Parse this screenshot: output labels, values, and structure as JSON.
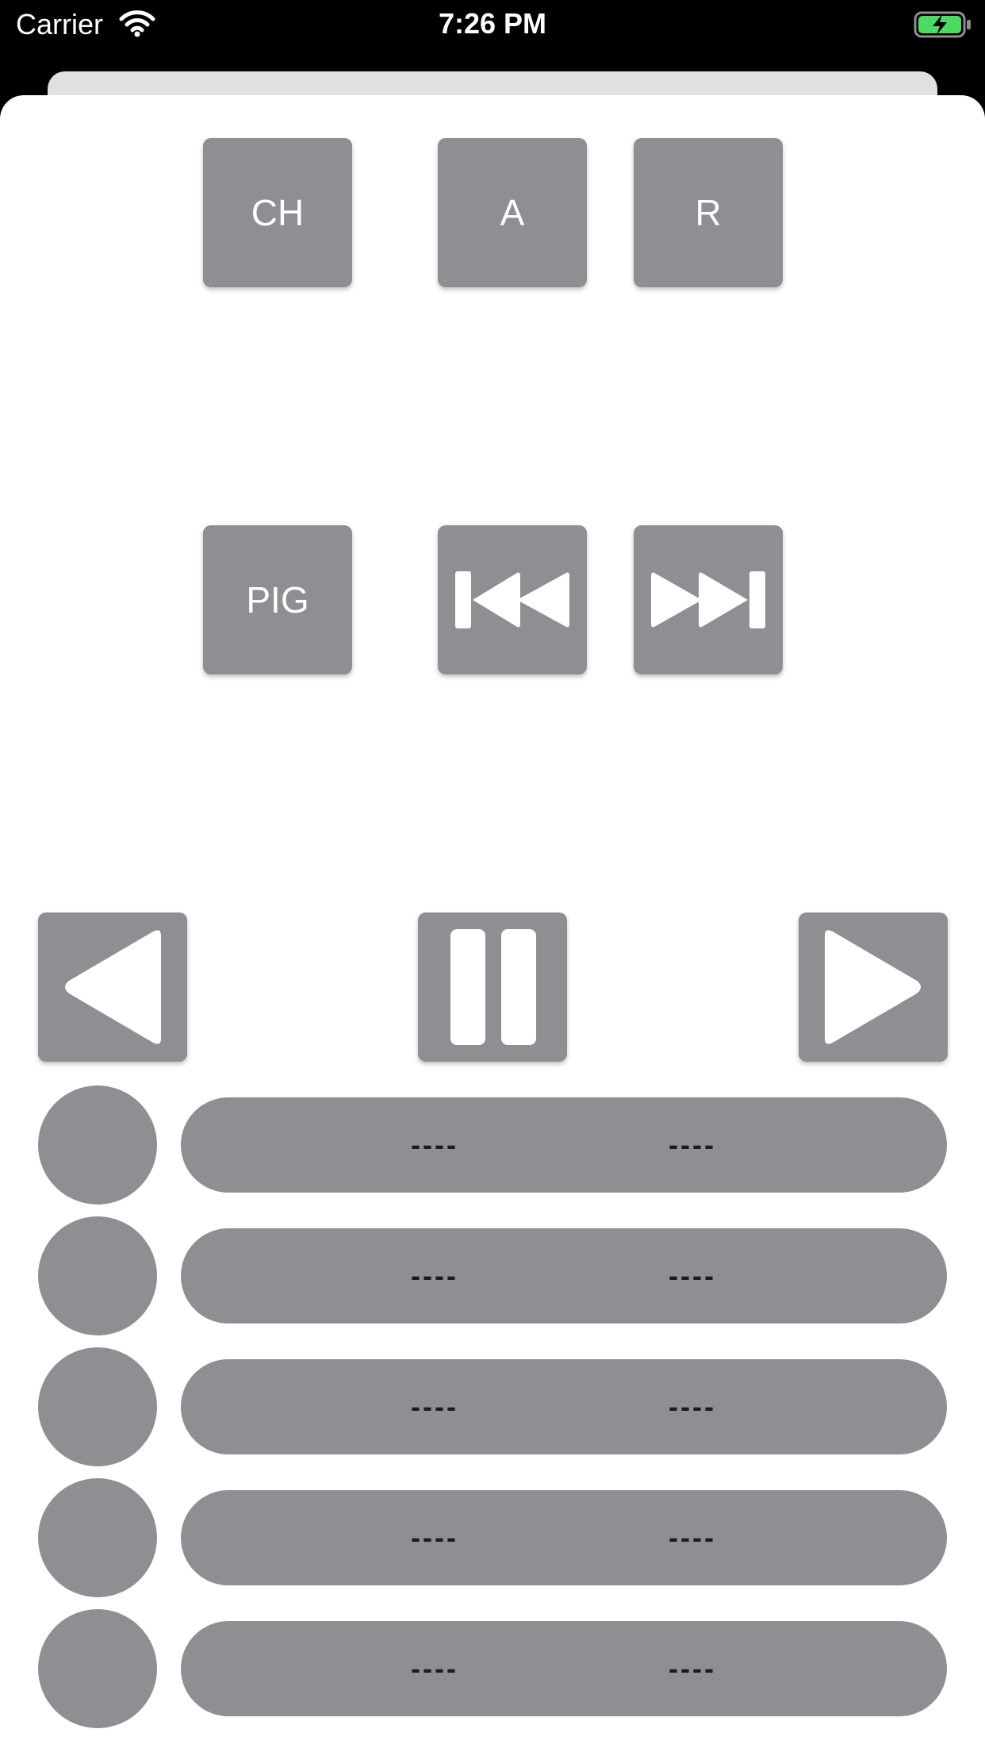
{
  "status_bar": {
    "carrier": "Carrier",
    "time": "7:26 PM",
    "wifi_icon": "wifi-icon",
    "battery_icon": "battery-charging-icon",
    "battery_color": "#4cd964"
  },
  "colors": {
    "button_gray": "#8e8e93",
    "sheet_background": "#ffffff",
    "value_text": "#1c1c1e"
  },
  "top_buttons": {
    "ch": "CH",
    "a": "A",
    "r": "R"
  },
  "middle_buttons": {
    "pig": "PIG",
    "previous_icon": "skip-back-icon",
    "next_icon": "skip-forward-icon"
  },
  "playback": {
    "left_icon": "triangle-left-icon",
    "pause_icon": "pause-icon",
    "right_icon": "triangle-right-icon"
  },
  "rows": [
    {
      "value_1": "----",
      "value_2": "----"
    },
    {
      "value_1": "----",
      "value_2": "----"
    },
    {
      "value_1": "----",
      "value_2": "----"
    },
    {
      "value_1": "----",
      "value_2": "----"
    },
    {
      "value_1": "----",
      "value_2": "----"
    }
  ]
}
